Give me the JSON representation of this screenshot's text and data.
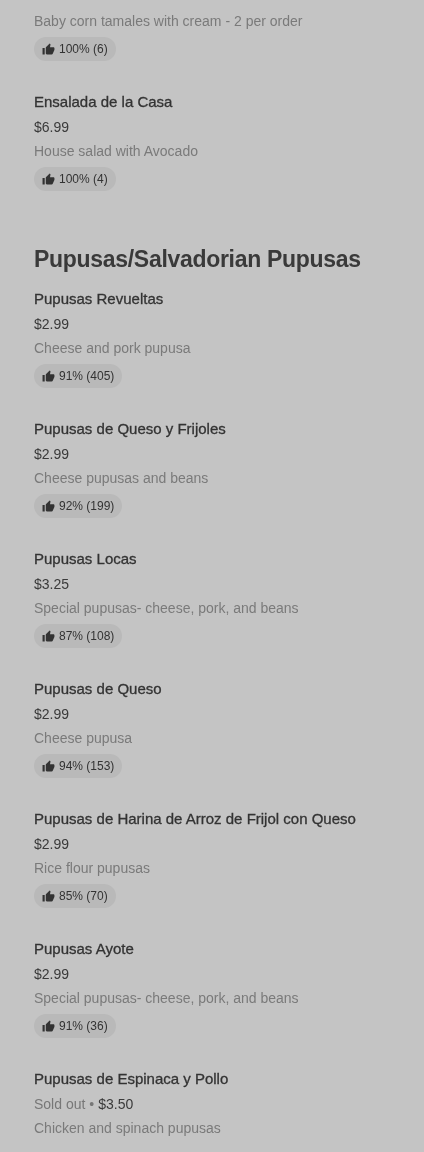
{
  "sections": [
    {
      "items": [
        {
          "description": "Baby corn tamales with cream - 2 per order",
          "rating": "100% (6)"
        },
        {
          "name": "Ensalada de la Casa",
          "price": "$6.99",
          "description": "House salad with Avocado",
          "rating": "100% (4)"
        }
      ]
    },
    {
      "title": "Pupusas/Salvadorian Pupusas",
      "items": [
        {
          "name": "Pupusas Revueltas",
          "price": "$2.99",
          "description": "Cheese and pork pupusa",
          "rating": "91% (405)"
        },
        {
          "name": "Pupusas de Queso y Frijoles",
          "price": "$2.99",
          "description": "Cheese pupusas and beans",
          "rating": "92% (199)"
        },
        {
          "name": "Pupusas Locas",
          "price": "$3.25",
          "description": "Special pupusas- cheese, pork, and beans",
          "rating": "87% (108)"
        },
        {
          "name": "Pupusas de Queso",
          "price": "$2.99",
          "description": "Cheese pupusa",
          "rating": "94% (153)"
        },
        {
          "name": "Pupusas de Harina de Arroz de Frijol con Queso",
          "price": "$2.99",
          "description": "Rice flour pupusas",
          "rating": "85% (70)"
        },
        {
          "name": "Pupusas Ayote",
          "price": "$2.99",
          "description": "Special pupusas- cheese, pork, and beans",
          "rating": "91% (36)"
        },
        {
          "name": "Pupusas de Espinaca y Pollo",
          "status": "Sold out •",
          "price": "$3.50",
          "description": "Chicken and spinach pupusas"
        }
      ]
    }
  ]
}
